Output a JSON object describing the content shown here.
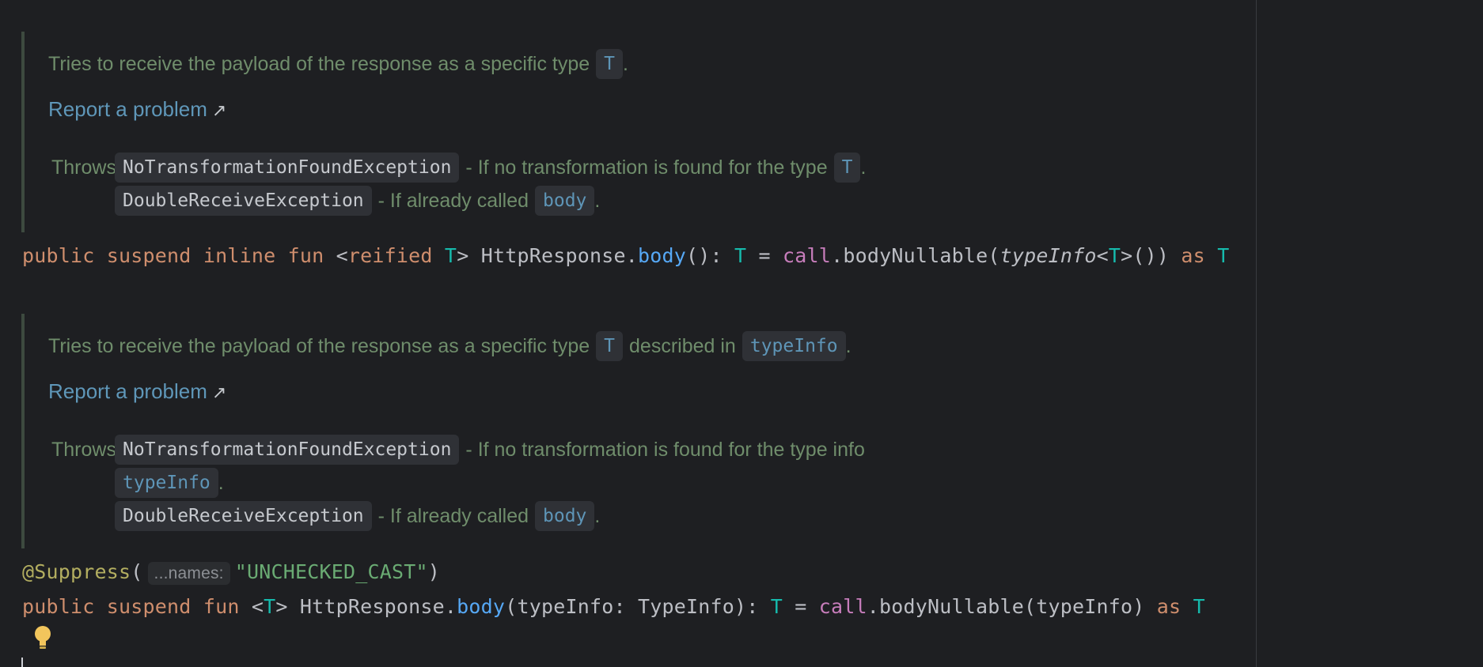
{
  "doc1": {
    "desc_text": "Tries to receive the payload of the response as a specific type",
    "desc_type": "T",
    "desc_end": ".",
    "report_label": "Report a problem",
    "throws_label": "Throws:",
    "throws": [
      {
        "exception": "NoTransformationFoundException",
        "text": "- If no transformation is found for the type",
        "ref": "T",
        "end": "."
      },
      {
        "exception": "DoubleReceiveException",
        "text": "- If already called",
        "ref": "body",
        "end": "."
      }
    ]
  },
  "code1": {
    "kw_public": "public",
    "kw_suspend": "suspend",
    "kw_inline": "inline",
    "kw_fun": "fun",
    "lt": "<",
    "kw_reified": "reified",
    "tp_T1": "T",
    "gt_sp": "> ",
    "receiver": "HttpResponse.",
    "fn_body": "body",
    "sig": "(): ",
    "tp_T2": "T",
    "eq": " = ",
    "call": "call",
    "dot_nullable": ".bodyNullable(",
    "type_info": "typeInfo",
    "lt2": "<",
    "tp_T3": "T",
    "close": ">()) ",
    "kw_as": "as",
    "tp_T4": "T"
  },
  "doc2": {
    "desc_text": "Tries to receive the payload of the response as a specific type",
    "desc_type": "T",
    "desc_mid": "described in",
    "desc_ref": "typeInfo",
    "desc_end": ".",
    "report_label": "Report a problem",
    "throws_label": "Throws:",
    "throws": [
      {
        "exception": "NoTransformationFoundException",
        "text": "- If no transformation is found for the type info",
        "ref": "typeInfo",
        "end": "."
      },
      {
        "exception": "DoubleReceiveException",
        "text": "- If already called",
        "ref": "body",
        "end": "."
      }
    ]
  },
  "code2": {
    "annotation": "@Suppress",
    "open_paren": "(",
    "hint_label": "...names:",
    "string_value": "\"UNCHECKED_CAST\"",
    "close_paren": ")",
    "kw_public": "public",
    "kw_suspend": "suspend",
    "kw_fun": "fun",
    "lt": "<",
    "tp_T1": "T",
    "gt_sp": "> ",
    "receiver": "HttpResponse.",
    "fn_body": "body",
    "params": "(typeInfo: TypeInfo): ",
    "tp_T2": "T",
    "eq": " = ",
    "call": "call",
    "rest": ".bodyNullable(typeInfo) ",
    "kw_as": "as",
    "tp_T3": "T"
  },
  "icons": {
    "report_arrow": "external-link-icon",
    "intention": "lightbulb-icon"
  },
  "colors": {
    "background": "#1e1f22",
    "doc_text": "#6f8d6b",
    "link": "#5f97b9",
    "keyword": "#cf8e6d",
    "type_param": "#16baac",
    "function": "#56a8f5",
    "property": "#c77dbb",
    "annotation": "#b3ae60",
    "string": "#6aab73"
  }
}
